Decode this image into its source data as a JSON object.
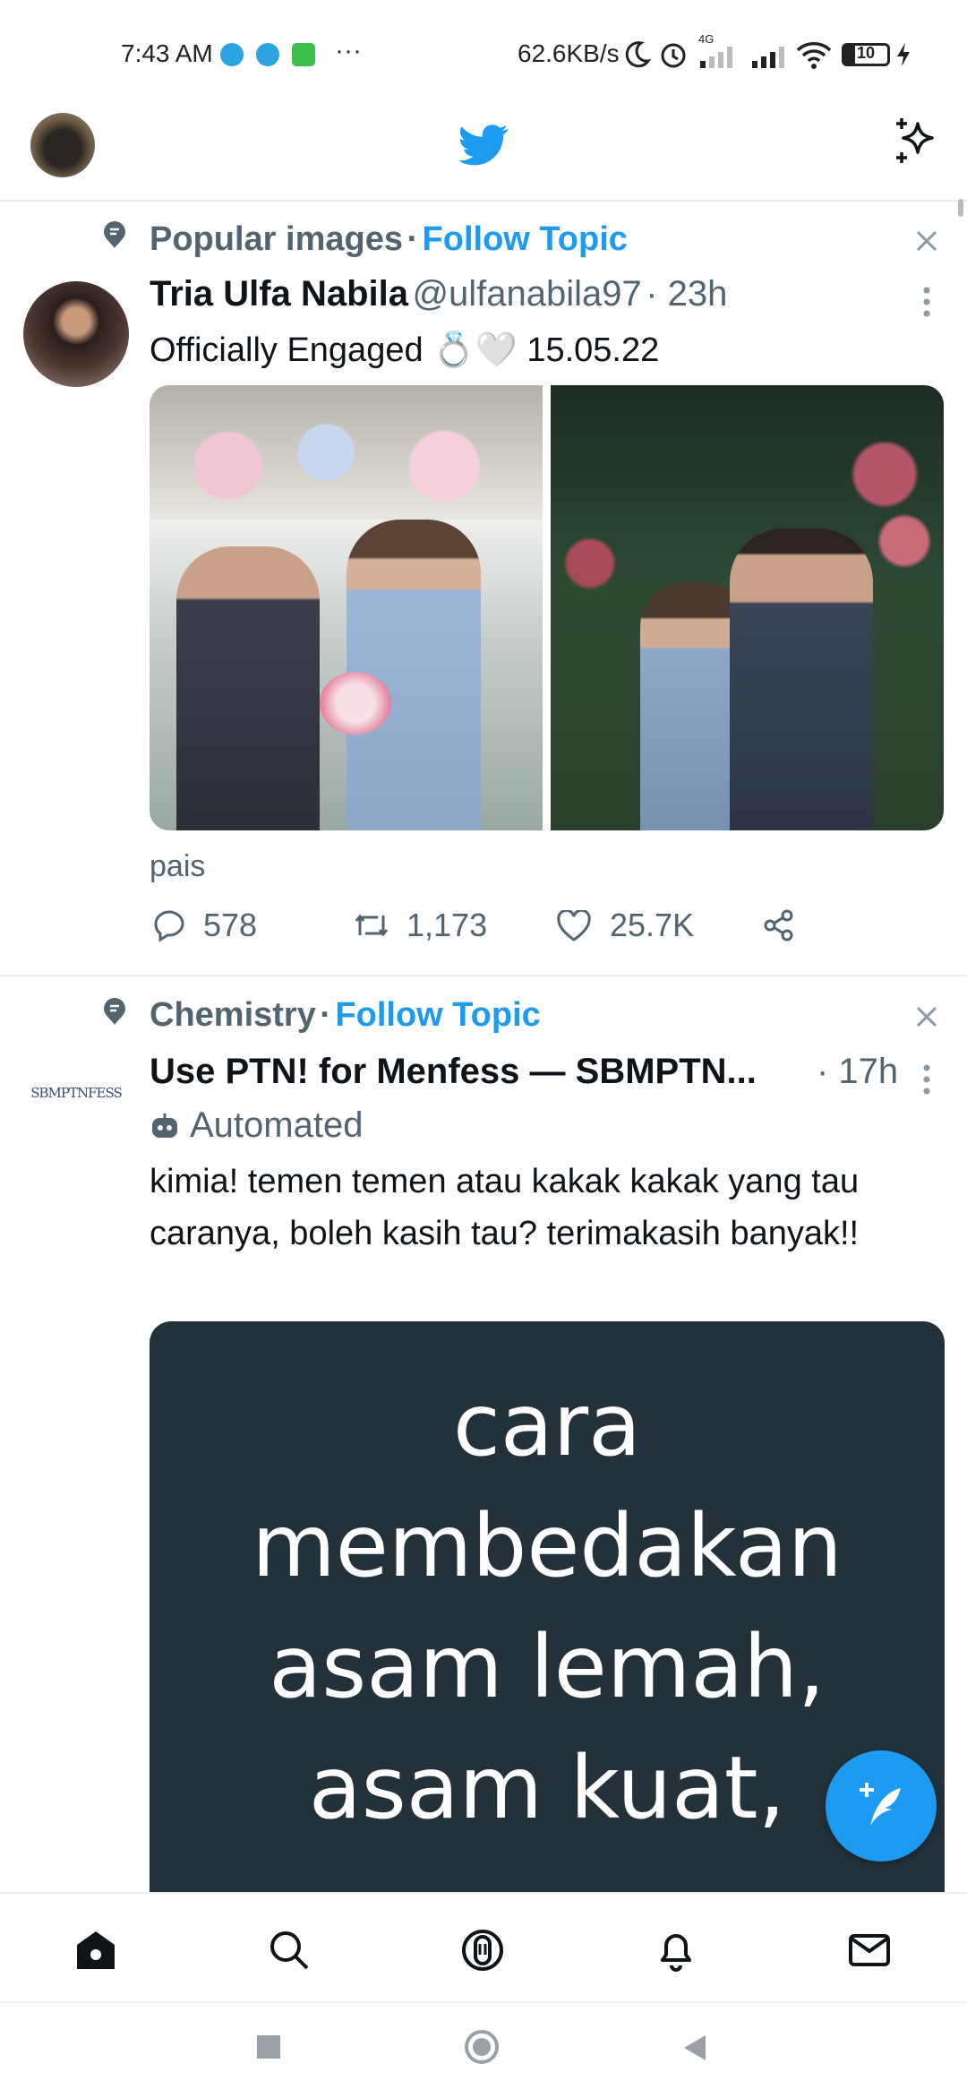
{
  "status_bar": {
    "time": "7:43 AM",
    "more": "···",
    "speed": "62.6KB/s",
    "network": "4G",
    "battery": "10"
  },
  "header": {
    "logo_icon": "twitter-bird-icon",
    "sparkle_icon": "sparkle-icon"
  },
  "tweets": [
    {
      "topic": "Popular images",
      "separator": "·",
      "follow_label": "Follow Topic",
      "author_name": "Tria Ulfa Nabila",
      "handle": "@ulfanabila97",
      "time": "· 23h",
      "text": "Officially Engaged 💍🤍 15.05.22",
      "caption": "pais",
      "replies": "578",
      "retweets": "1,173",
      "likes": "25.7K"
    },
    {
      "topic": "Chemistry",
      "separator": "·",
      "follow_label": "Follow Topic",
      "author_name": "Use PTN! for Menfess — SBMPTN...",
      "time": "· 17h",
      "avatar_text": "SBMPTNFESS",
      "automated_label": "Automated",
      "text": "kimia! temen temen atau kakak kakak yang tau caranya, boleh kasih tau? terimakasih banyak!!",
      "card_lines": [
        "cara",
        "membedakan",
        "asam lemah,",
        "asam kuat,"
      ]
    }
  ],
  "colors": {
    "accent": "#1d9bf0",
    "card_bg": "#23313b",
    "muted": "#536471"
  }
}
